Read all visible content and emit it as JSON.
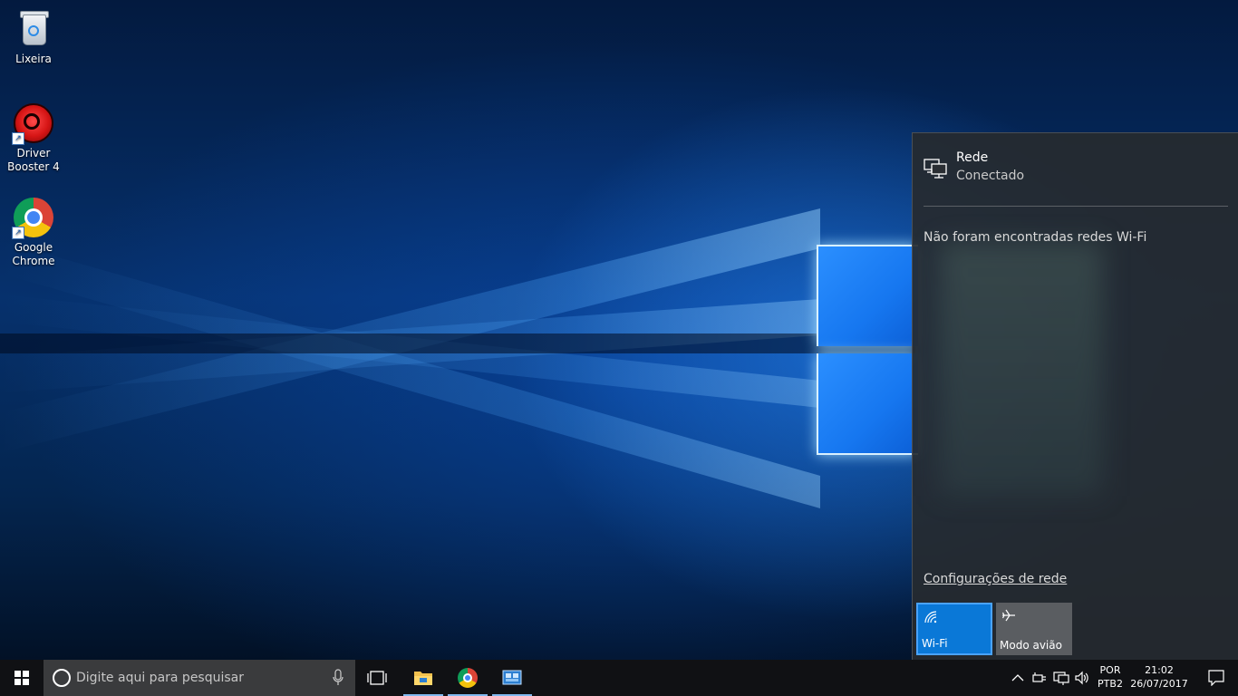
{
  "desktop": {
    "icons": [
      {
        "label": "Lixeira",
        "icon": "recycle-bin-icon"
      },
      {
        "label": "Driver\nBooster 4",
        "line1": "Driver",
        "line2": "Booster 4",
        "icon": "driver-booster-icon"
      },
      {
        "label": "Google\nChrome",
        "line1": "Google",
        "line2": "Chrome",
        "icon": "chrome-icon"
      }
    ]
  },
  "network_flyout": {
    "network_name": "Rede",
    "network_status": "Conectado",
    "no_wifi_message": "Não foram encontradas redes Wi-Fi",
    "settings_link": "Configurações de rede",
    "tiles": [
      {
        "label": "Wi-Fi",
        "icon": "wifi-icon",
        "active": true
      },
      {
        "label": "Modo avião",
        "icon": "airplane-icon",
        "active": false
      }
    ]
  },
  "taskbar": {
    "search_placeholder": "Digite aqui para pesquisar",
    "language_line1": "POR",
    "language_line2": "PTB2",
    "time": "21:02",
    "date": "26/07/2017",
    "pinned": [
      "task-view-icon",
      "file-explorer-icon",
      "chrome-icon",
      "network-app-icon"
    ]
  },
  "colors": {
    "accent": "#0a78d7",
    "taskbar": "#101114",
    "flyout_bg": "#262a2f"
  }
}
